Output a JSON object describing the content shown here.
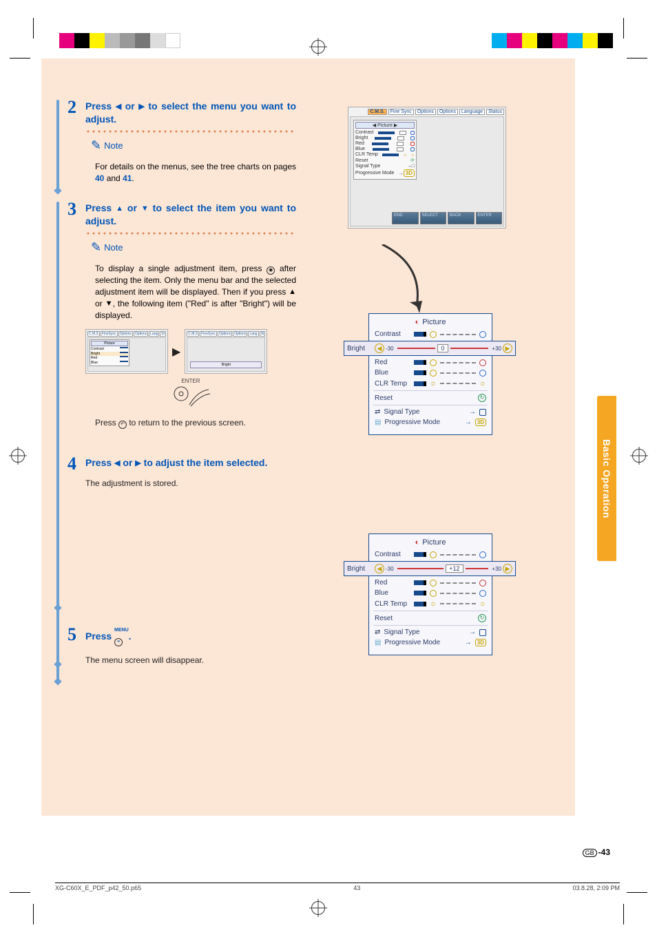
{
  "side_tab": "Basic Operation",
  "steps": {
    "s2": {
      "num": "2",
      "instr_pre": "Press ",
      "instr_mid": " or ",
      "instr_post": " to select the menu you want to adjust.",
      "note_label": "Note",
      "note_body_pre": "For details on the menus, see the tree charts on pages ",
      "pg1": "40",
      "and": " and ",
      "pg2": "41",
      "dot": "."
    },
    "s3": {
      "num": "3",
      "instr_pre": "Press ",
      "instr_mid": " or ",
      "instr_post": " to select the item you want to adjust.",
      "note_label": "Note",
      "note_body": "To display a single adjustment item, press   after selecting the item. Only the menu bar and the selected adjustment item will be displayed. Then if you press ▲ or ▼, the following item (\"Red\" is after \"Bright\") will be displayed.",
      "enter_label": "ENTER",
      "return_text": "Press   to return to the previous screen."
    },
    "s4": {
      "num": "4",
      "instr_pre": "Press ",
      "instr_mid": " or ",
      "instr_post": " to adjust the item selected.",
      "body": "The adjustment is stored."
    },
    "s5": {
      "num": "5",
      "instr_pre": "Press ",
      "instr_post": ".",
      "menu_label": "MENU",
      "body": "The menu screen will disappear."
    }
  },
  "osd": {
    "tabs": [
      "C.M.S.",
      "Fine Sync",
      "Options",
      "Options",
      "Language",
      "Status"
    ],
    "menu_title": "Picture",
    "items": {
      "contrast": "Contrast",
      "bright": "Bright",
      "red": "Red",
      "blue": "Blue",
      "clr_temp": "CLR Temp",
      "reset": "Reset",
      "signal": "Signal Type",
      "progressive": "Progressive Mode"
    },
    "status": {
      "end": "END",
      "select": "SELECT",
      "back": "BACK",
      "enter": "ENTER"
    }
  },
  "bright_strip": {
    "label": "Bright",
    "neg": "-30",
    "pos": "+30",
    "val0": "0",
    "val12": "+12"
  },
  "footer": {
    "file": "XG-C60X_E_PDF_p42_50.p65",
    "seq": "43",
    "date": "03.8.28, 2:09 PM",
    "page_suffix": "-43",
    "gb": "GB"
  }
}
